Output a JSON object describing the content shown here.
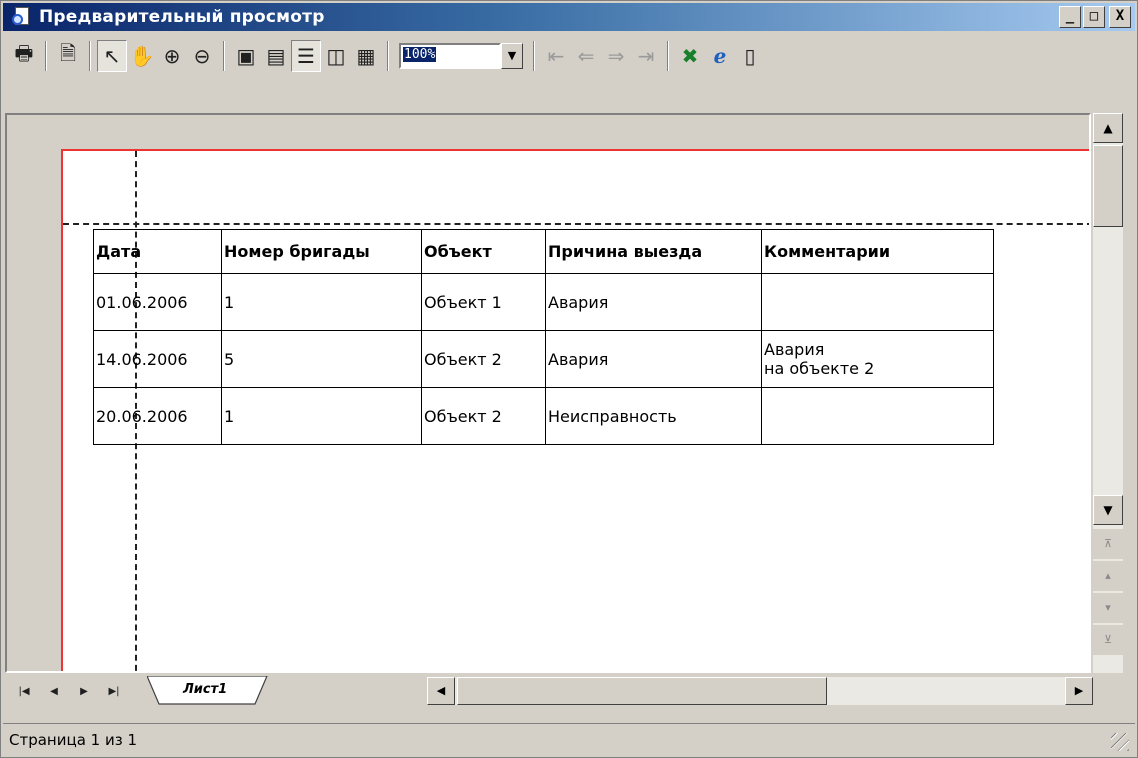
{
  "window": {
    "title": "Предварительный просмотр",
    "controls": {
      "minimize": "_",
      "maximize": "□",
      "close": "X"
    }
  },
  "toolbar": {
    "zoom_value": "100%",
    "icons": [
      "printer-icon",
      "page-setup-icon",
      "select-pointer-icon",
      "hand-icon",
      "zoom-in-icon",
      "zoom-out-icon",
      "zoom-fit-icon",
      "zoom-whole-icon",
      "one-page-icon",
      "two-pages-icon",
      "multi-page-icon",
      "first-page-icon",
      "prev-page-icon",
      "next-page-icon",
      "last-page-icon",
      "export-excel-icon",
      "export-html-icon",
      "export-text-icon"
    ]
  },
  "report": {
    "headers": [
      "Дата",
      "Номер бригады",
      "Объект",
      "Причина выезда",
      "Комментарии"
    ],
    "rows": [
      [
        "01.06.2006",
        "1",
        "Объект 1",
        "Авария",
        ""
      ],
      [
        "14.06.2006",
        "5",
        "Объект 2",
        "Авария",
        "Авария\nна объекте 2"
      ],
      [
        "20.06.2006",
        "1",
        "Объект 2",
        "Неисправность",
        ""
      ]
    ]
  },
  "sheet_tab": {
    "label": "Лист1"
  },
  "status": {
    "text": "Страница 1 из 1"
  }
}
